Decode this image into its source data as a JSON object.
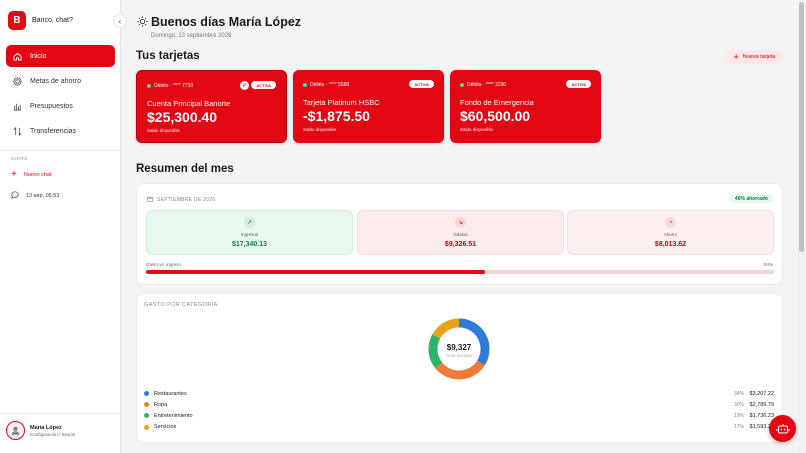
{
  "brand": {
    "logo_letter": "B",
    "name": "Banco, chat?"
  },
  "nav": [
    {
      "label": "Inicio",
      "icon": "home-icon",
      "active": true
    },
    {
      "label": "Metas de ahorro",
      "icon": "target-icon",
      "active": false
    },
    {
      "label": "Presupuestos",
      "icon": "budget-icon",
      "active": false
    },
    {
      "label": "Transferencias",
      "icon": "transfer-icon",
      "active": false
    }
  ],
  "chats": {
    "label": "CHATS",
    "new_chat": "Nuevo chat",
    "history": [
      "13 sep, 05:53"
    ]
  },
  "user": {
    "name": "María López",
    "subtitle": "Configuración / Sesión"
  },
  "header": {
    "greeting": "Buenos días María López",
    "date": "Domingo, 13 septiembre 2026"
  },
  "cards_section": {
    "title": "Tus tarjetas",
    "new_button": "Nueva tarjeta"
  },
  "cards": [
    {
      "debit": "Débito · **** 7710",
      "badge": "ACTIVA",
      "name": "Cuenta Principal Banorte",
      "amount": "$25,300.40",
      "available": "Saldo disponible",
      "selected": true
    },
    {
      "debit": "Débito · **** 5588",
      "badge": "ACTIVA",
      "name": "Tarjeta Platinum HSBC",
      "amount": "-$1,875.50",
      "available": "Saldo disponible",
      "selected": false
    },
    {
      "debit": "Débito · **** 2290",
      "badge": "ACTIVA",
      "name": "Fondo de Emergencia",
      "amount": "$60,500.00",
      "available": "Saldo disponible",
      "selected": false
    }
  ],
  "summary": {
    "title": "Resumen del mes",
    "month": "SEPTIEMBRE DE 2026",
    "saved_badge": "46% ahorrado",
    "stats": [
      {
        "label": "Ingresos",
        "value": "$17,340.13",
        "icon": "trending-up-icon"
      },
      {
        "label": "Gastos",
        "value": "$9,326.51",
        "icon": "trending-down-icon"
      },
      {
        "label": "Ahorro",
        "value": "$8,013.62",
        "icon": "piggy-bank-icon"
      }
    ],
    "bar_label": "Gasto vs. ingreso",
    "bar_pct_text": "54%",
    "bar_fraction": 0.54
  },
  "categories": {
    "title": "GASTO POR CATEGORÍA",
    "total": "$9,327",
    "total_label": "TOTAL GASTADO",
    "items": [
      {
        "name": "Restaurantes",
        "pct": "34%",
        "value": "$3,207.22",
        "color": "#2f7bd8",
        "fraction": 0.34
      },
      {
        "name": "Ropa",
        "pct": "30%",
        "value": "$2,789.79",
        "color": "#f07a3a",
        "fraction": 0.3
      },
      {
        "name": "Entretenimiento",
        "pct": "19%",
        "value": "$1,736.23",
        "color": "#2fb36a",
        "fraction": 0.19
      },
      {
        "name": "Servicios",
        "pct": "17%",
        "value": "$1,593.27",
        "color": "#e9a21b",
        "fraction": 0.17
      }
    ]
  },
  "colors": {
    "accent": "#e30613",
    "income_bg": "#e9f8ee",
    "expense_bg": "#fdecec",
    "saving_bg": "#fdf0f0"
  }
}
